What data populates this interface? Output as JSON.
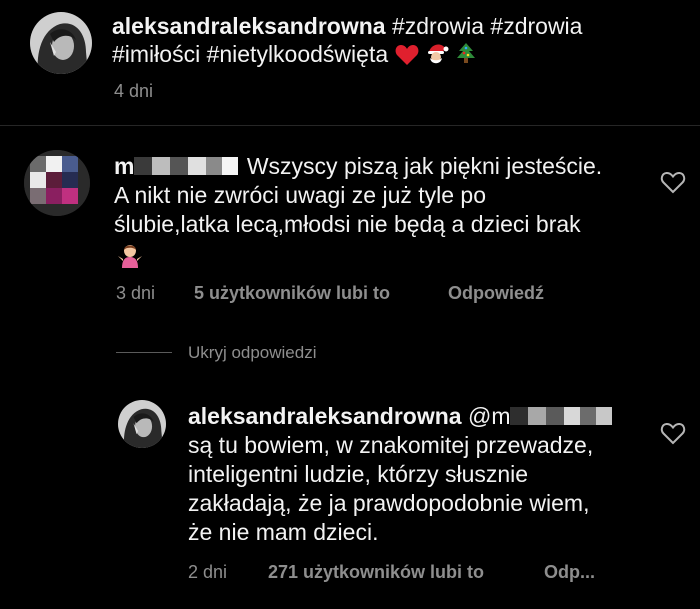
{
  "post": {
    "author": "aleksandraleksandrowna",
    "caption_line1": "#zdrowia #zdrowia",
    "caption_line2": "#imiłości #nietylkoodświęta",
    "caption_emoji_icons": [
      "red-heart-icon",
      "santa-icon",
      "christmas-tree-icon"
    ],
    "time": "4 dni"
  },
  "comment": {
    "username_visible": "m",
    "text_line1": "Wszyscy piszą jak piękni jesteście.",
    "text_line2": "A nikt nie zwróci uwagi ze już tyle po",
    "text_line3": "ślubie,latka lecą,młodsi nie będą a dzieci brak",
    "emoji_icon": "person-shrugging-icon",
    "time": "3 dni",
    "likes": "5 użytkowników lubi to",
    "reply_label": "Odpowiedź"
  },
  "replies_toggle": "Ukryj odpowiedzi",
  "reply": {
    "author": "aleksandraleksandrowna",
    "mention_visible": "@m",
    "text_line1": "są tu bowiem, w znakomitej przewadze,",
    "text_line2": "inteligentni ludzie, którzy słusznie",
    "text_line3": "zakładają, że ja prawdopodobnie wiem,",
    "text_line4": "że nie mam dzieci.",
    "time": "2 dni",
    "likes": "271 użytkowników lubi to",
    "reply_label": "Odp..."
  },
  "colors": {
    "background": "#000000",
    "text": "#f3f3f3",
    "meta": "#8e8e8e",
    "divider": "#262626"
  }
}
